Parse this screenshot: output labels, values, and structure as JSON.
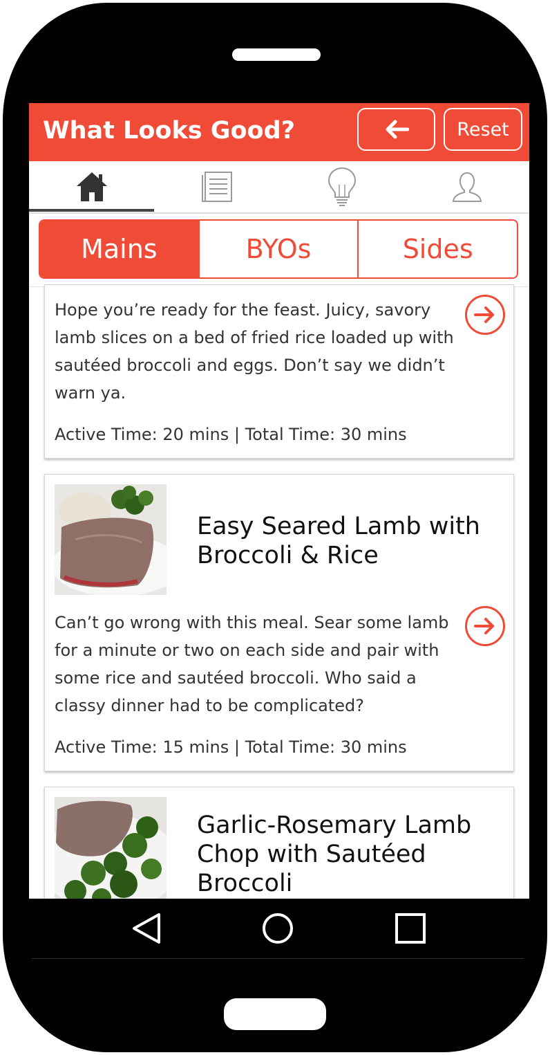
{
  "header": {
    "title": "What Looks Good?",
    "reset_label": "Reset",
    "accent_color": "#f04b37"
  },
  "tabs": [
    {
      "name": "home",
      "icon": "home-icon",
      "active": true
    },
    {
      "name": "recipes",
      "icon": "document-icon",
      "active": false
    },
    {
      "name": "ideas",
      "icon": "lightbulb-icon",
      "active": false
    },
    {
      "name": "profile",
      "icon": "user-icon",
      "active": false
    }
  ],
  "segments": [
    "Mains",
    "BYOs",
    "Sides"
  ],
  "active_segment": "Mains",
  "cards": [
    {
      "description": "Hope you’re ready for the feast. Juicy, savory lamb slices on a bed of fried rice loaded up with sautéed broccoli and eggs. Don’t say we didn’t warn ya.",
      "meta": "Active Time: 20 mins | Total Time: 30 mins"
    },
    {
      "title": "Easy Seared Lamb with Broccoli & Rice",
      "description": "Can’t go wrong with this meal. Sear some lamb for a minute or two on each side and pair with some rice and sautéed broccoli. Who said a classy dinner had to be complicated?",
      "meta": "Active Time: 15 mins | Total Time: 30 mins"
    },
    {
      "title": "Garlic-Rosemary Lamb Chop with Sautéed Broccoli"
    }
  ],
  "system_nav": [
    "back-icon",
    "home-circle-icon",
    "recents-square-icon"
  ]
}
